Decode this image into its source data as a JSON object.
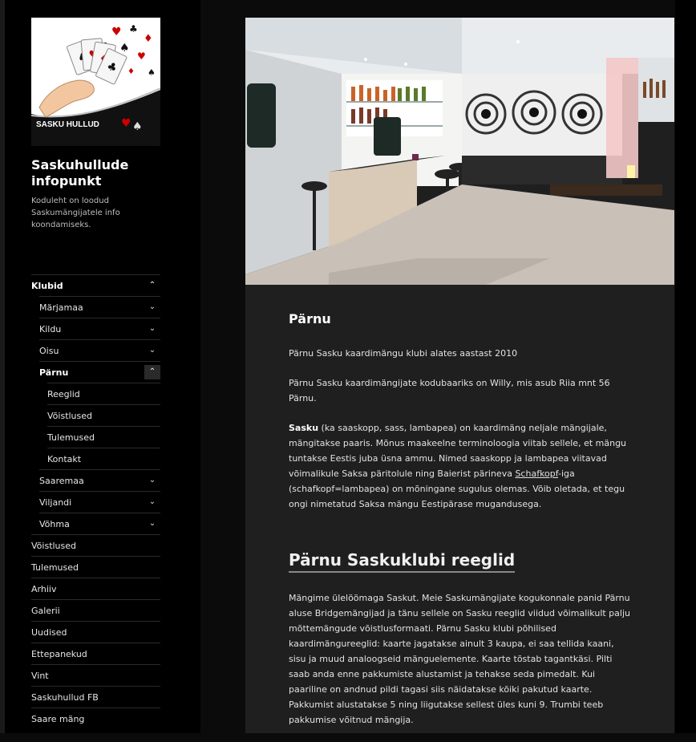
{
  "site": {
    "logo_text": "SASKU HULLUD",
    "title": "Saskuhullude infopunkt",
    "description": "Koduleht on loodud Saskumängijatele info koondamiseks."
  },
  "nav": [
    {
      "label": "Klubid",
      "level": 0,
      "bold": true,
      "toggle": "up"
    },
    {
      "label": "Märjamaa",
      "level": 1,
      "toggle": "down"
    },
    {
      "label": "Kildu",
      "level": 1,
      "toggle": "down"
    },
    {
      "label": "Oisu",
      "level": 1,
      "toggle": "down"
    },
    {
      "label": "Pärnu",
      "level": 1,
      "bold": true,
      "toggle": "up",
      "boxed": true
    },
    {
      "label": "Reeglid",
      "level": 2
    },
    {
      "label": "Võistlused",
      "level": 2
    },
    {
      "label": "Tulemused",
      "level": 2
    },
    {
      "label": "Kontakt",
      "level": 2
    },
    {
      "label": "Saaremaa",
      "level": 1,
      "toggle": "down"
    },
    {
      "label": "Viljandi",
      "level": 1,
      "toggle": "down"
    },
    {
      "label": "Võhma",
      "level": 1,
      "toggle": "down"
    },
    {
      "label": "Võistlused",
      "level": 0
    },
    {
      "label": "Tulemused",
      "level": 0
    },
    {
      "label": "Arhiiv",
      "level": 0
    },
    {
      "label": "Galerii",
      "level": 0
    },
    {
      "label": "Uudised",
      "level": 0
    },
    {
      "label": "Ettepanekud",
      "level": 0
    },
    {
      "label": "Vint",
      "level": 0
    },
    {
      "label": "Saskuhullud FB",
      "level": 0
    },
    {
      "label": "Saare mäng",
      "level": 0
    }
  ],
  "post": {
    "title": "Pärnu",
    "p1": "Pärnu Sasku kaardimängu klubi alates aastast 2010",
    "p2": "Pärnu Sasku kaardimängijate kodubaariks on Willy, mis asub Riia mnt 56 Pärnu.",
    "p3_strong": "Sasku",
    "p3_a": " (ka saaskopp, sass, lambapea) on kaardimäng neljale mängijale, mängitakse paaris. Mõnus maakeelne terminoloogia viitab sellele, et mängu tuntakse Eestis juba üsna ammu. Nimed saaskopp ja lambapea viitavad võimalikule Saksa päritolule ning Baierist pärineva ",
    "p3_link": "Schafkopf",
    "p3_b": "-iga (schafkopf=lambapea) on mõningane sugulus olemas. Võib oletada, et tegu ongi nimetatud Saksa mängu Eestipärase mugandusega.",
    "h2": "Pärnu Saskuklubi reeglid",
    "p4": "Mängime ülelöömaga Saskut. Meie Saskumängijate kogukonnale panid Pärnu aluse Bridgemängijad ja tänu sellele on Sasku reeglid viidud võimalikult palju mõttemängude võistlusformaati. Pärnu Sasku klubi põhilised kaardimängureeglid: kaarte jagatakse ainult 3 kaupa, ei saa tellida kaani, sisu ja muud analoogseid mänguelemente. Kaarte tõstab tagantkäsi. Pilti saab anda enne pakkumiste alustamist ja tehakse seda pimedalt. Kui paariline on andnud pildi tagasi siis näidatakse kõiki pakutud kaarte. Pakkumist alustatakse 5 ning liigutakse sellest üles kuni 9. Trumbi teeb pakkumise võitnud mängija."
  },
  "icons": {
    "toggle_down": "chevron-down-icon",
    "toggle_up": "chevron-up-icon"
  }
}
